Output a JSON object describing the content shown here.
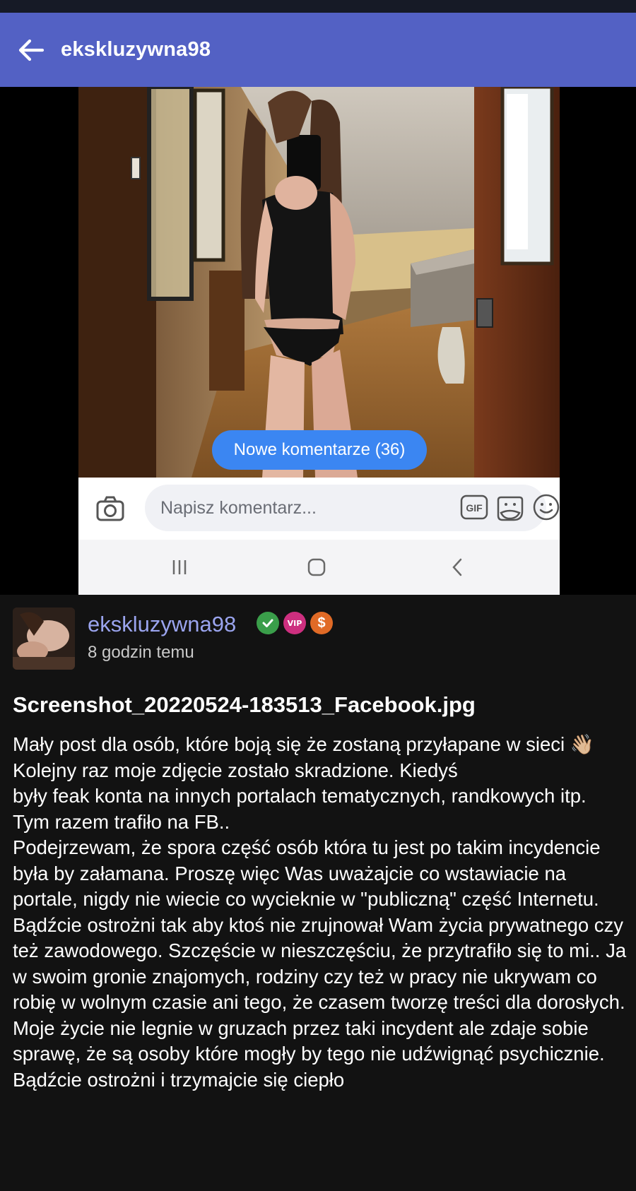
{
  "app_bar": {
    "title": "ekskluzywna98"
  },
  "media": {
    "new_comments_label": "Nowe komentarze (36)",
    "comment_placeholder": "Napisz komentarz...",
    "gif_label": "GIF"
  },
  "post": {
    "author": "ekskluzywna98",
    "badges": {
      "vip_label": "VIP",
      "dollar_label": "$"
    },
    "time": "8 godzin temu",
    "title": "Screenshot_20220524-183513_Facebook.jpg",
    "body": [
      "Mały post dla osób, które boją się że zostaną przyłapane w sieci 👋🏼",
      "Kolejny raz moje zdjęcie zostało skradzione. Kiedyś",
      "były feak konta na innych portalach tematycznych, randkowych itp. Tym razem trafiło na FB..",
      "Podejrzewam, że spora część osób która tu jest po takim incydencie była by załamana. Proszę więc Was uważajcie co wstawiacie na portale, nigdy nie wiecie co wycieknie w \"publiczną\" część Internetu. Bądźcie ostrożni tak aby ktoś nie zrujnował Wam życia prywatnego czy też zawodowego. Szczęście w nieszczęściu, że przytrafiło się to mi.. Ja w swoim gronie znajomych, rodziny czy też w pracy nie ukrywam co robię w wolnym czasie ani tego, że czasem tworzę treści dla dorosłych. Moje życie nie legnie w gruzach przez taki incydent ale zdaje sobie sprawę, że są osoby które mogły by tego nie udźwignąć psychicznie.",
      "Bądźcie ostrożni i trzymajcie się ciepło"
    ]
  },
  "colors": {
    "app_bar": "#5361c4",
    "background": "#121212",
    "author_name": "#9aa4ee",
    "new_comments_pill": "#3b86f2",
    "verified_badge": "#3a9e4a",
    "vip_badge": "#cd2f7f",
    "dollar_badge": "#e06a26"
  },
  "icons": [
    "arrow-left-icon",
    "camera-icon",
    "gif-icon",
    "sticker-icon",
    "smile-icon",
    "recent-apps-icon",
    "home-icon",
    "chevron-left-icon",
    "check-icon"
  ]
}
